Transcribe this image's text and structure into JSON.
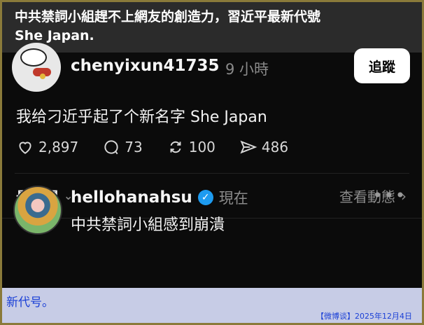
{
  "banner": {
    "line1": "中共禁詞小組趕不上網友的創造力，習近平最新代號",
    "line2": "She Japan."
  },
  "post1": {
    "username": "chenyixun41735",
    "time": "9 小時",
    "follow_label": "追蹤",
    "text": "我给刁近乎起了个新名字  She Japan",
    "likes": "2,897",
    "comments": "73",
    "reposts": "100",
    "shares": "486"
  },
  "sort": {
    "label": "最相關",
    "view_activity": "查看動態"
  },
  "post2": {
    "username": "hellohanahsu",
    "time": "現在",
    "text": "中共禁詞小組感到崩潰"
  },
  "footer": {
    "text": "新代号。",
    "source": "【微博谈】2025年12月4日"
  },
  "colors": {
    "accent_blue": "#1d9bf0",
    "footer_bg": "#c7cce6",
    "footer_text": "#1a3fd6"
  },
  "icons": [
    "heart-icon",
    "comment-icon",
    "repost-icon",
    "share-icon",
    "chevron-down-icon",
    "chevron-right-icon",
    "verified-icon",
    "more-icon"
  ]
}
